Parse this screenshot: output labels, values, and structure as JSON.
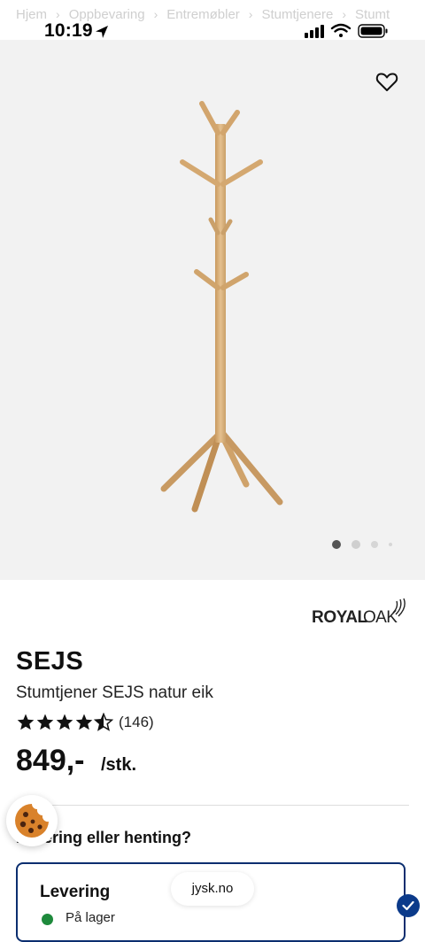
{
  "breadcrumb": [
    "Hjem",
    "Oppbevaring",
    "Entremøbler",
    "Stumtjenere",
    "Stumt"
  ],
  "breadcrumb_separator": "›",
  "status_bar": {
    "time": "10:19"
  },
  "gallery": {
    "slide_count": 4,
    "active_slide": 1
  },
  "brand": {
    "name": "ROYALOAK"
  },
  "product": {
    "name": "SEJS",
    "subtitle": "Stumtjener SEJS natur eik",
    "rating": 4.5,
    "rating_max": 5,
    "review_count": "(146)",
    "price": "849,-",
    "unit": "/stk."
  },
  "delivery": {
    "question": "Levering eller henting?",
    "card_title": "Levering",
    "stock_status": "På lager",
    "stock_color": "#1e8a3c",
    "border_color": "#0b2e6f"
  },
  "browser": {
    "url": "jysk.no"
  },
  "icons": {
    "favorite": "heart-outline-icon",
    "location": "location-arrow-icon",
    "cookie": "cookie-icon",
    "selected": "check-icon"
  }
}
